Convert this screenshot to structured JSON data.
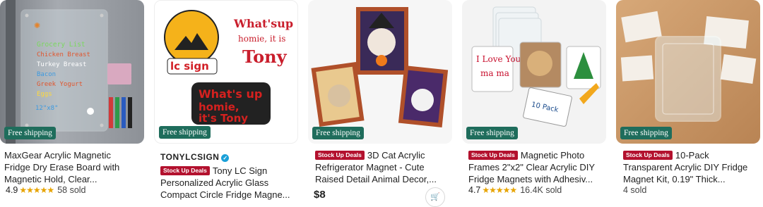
{
  "products": [
    {
      "badge": "Free shipping",
      "title_lines": [
        "MaxGear Acrylic Magnetic",
        "Fridge Dry Erase Board with",
        "Magnetic Hold, Clear..."
      ],
      "rating": "4.9",
      "stars": "★★★★★",
      "sold": "58 sold",
      "board_text": [
        "Grocery List",
        "Chicken Breast",
        "Turkey Breast",
        "Bacon",
        "Greek Yogurt",
        "Eggs",
        "12\"x8\""
      ]
    },
    {
      "badge": "Free shipping",
      "seller": "TONYLCSIGN",
      "deal": "Stock Up Deals",
      "title_first": "Tony LC Sign",
      "title_lines": [
        "Personalized Acrylic Glass",
        "Compact Circle Fridge Magne..."
      ],
      "sticker_text": [
        "lc sign",
        "What'sup",
        "homie, it is",
        "Tony",
        "What's up",
        "homie,",
        "it's Tony"
      ]
    },
    {
      "badge": "Free shipping",
      "deal": "Stock Up Deals",
      "title_first": "3D Cat Acrylic",
      "title_lines": [
        "Refrigerator Magnet - Cute",
        "Raised Detail Animal Decor,..."
      ],
      "price": "$8"
    },
    {
      "badge": "Free shipping",
      "deal": "Stock Up Deals",
      "title_first": "Magnetic Photo",
      "title_lines": [
        "Frames 2\"x2\" Clear Acrylic DIY",
        "Fridge Magnets with Adhesiv..."
      ],
      "rating": "4.7",
      "stars": "★★★★★",
      "sold": "16.4K sold",
      "frame_text": [
        "I Love You",
        "ma ma",
        "10 Pack"
      ]
    },
    {
      "badge": "Free shipping",
      "deal": "Stock Up Deals",
      "title_first": "10-Pack",
      "title_lines": [
        "Transparent Acrylic DIY Fridge",
        "Magnet Kit, 0.19\" Thick..."
      ],
      "sold": "4 sold"
    }
  ]
}
